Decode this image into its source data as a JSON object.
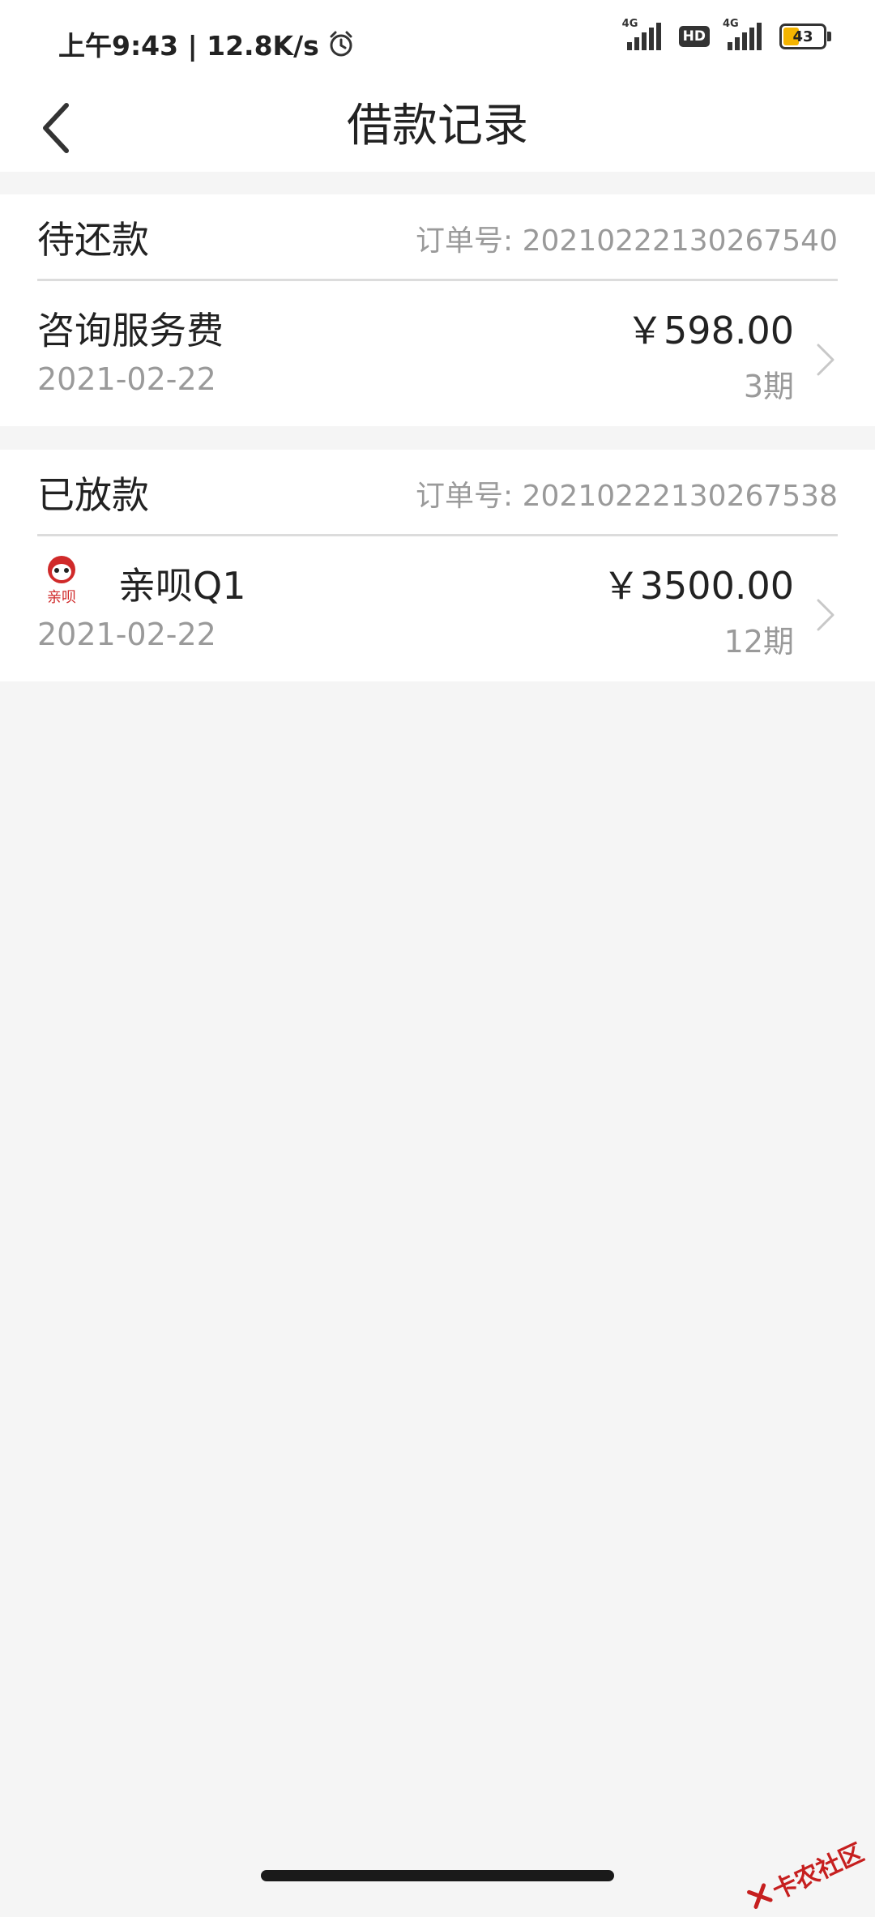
{
  "status_bar": {
    "time_text": "上午9:43 | 12.8K/s",
    "net1": "4G",
    "hd": "HD",
    "net2": "4G",
    "battery": "43",
    "battery_level": 0.43
  },
  "nav": {
    "title": "借款记录"
  },
  "records": [
    {
      "status": "待还款",
      "order_no": "订单号: 20210222130267540",
      "name": "咨询服务费",
      "date": "2021-02-22",
      "amount": "￥598.00",
      "term": "3期"
    },
    {
      "status": "已放款",
      "order_no": "订单号: 20210222130267538",
      "name": "亲呗Q1",
      "logo_text": "亲呗",
      "date": "2021-02-22",
      "amount": "￥3500.00",
      "term": "12期"
    }
  ],
  "watermark": "卡农社区",
  "colors": {
    "accent": "#c61f1f",
    "muted_text": "#9a9a9a",
    "background": "#f5f5f5"
  }
}
